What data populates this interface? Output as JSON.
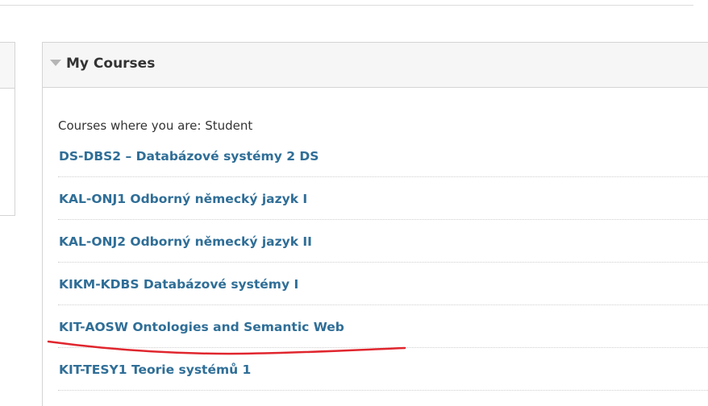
{
  "module": {
    "title": "My Courses",
    "toggle_icon": "triangle-down-icon"
  },
  "role_label": "Courses where you are: Student",
  "courses": [
    {
      "label": "DS-DBS2 – Databázové systémy 2 DS"
    },
    {
      "label": "KAL-ONJ1 Odborný německý jazyk I"
    },
    {
      "label": "KAL-ONJ2 Odborný německý jazyk II"
    },
    {
      "label": "KIKM-KDBS Databázové systémy I"
    },
    {
      "label": "KIT-AOSW Ontologies and Semantic Web"
    },
    {
      "label": "KIT-TESY1 Teorie systémů 1"
    }
  ],
  "colors": {
    "link": "#2f6e97",
    "annotation": "#e0262e",
    "header_bg": "#f6f6f6"
  }
}
